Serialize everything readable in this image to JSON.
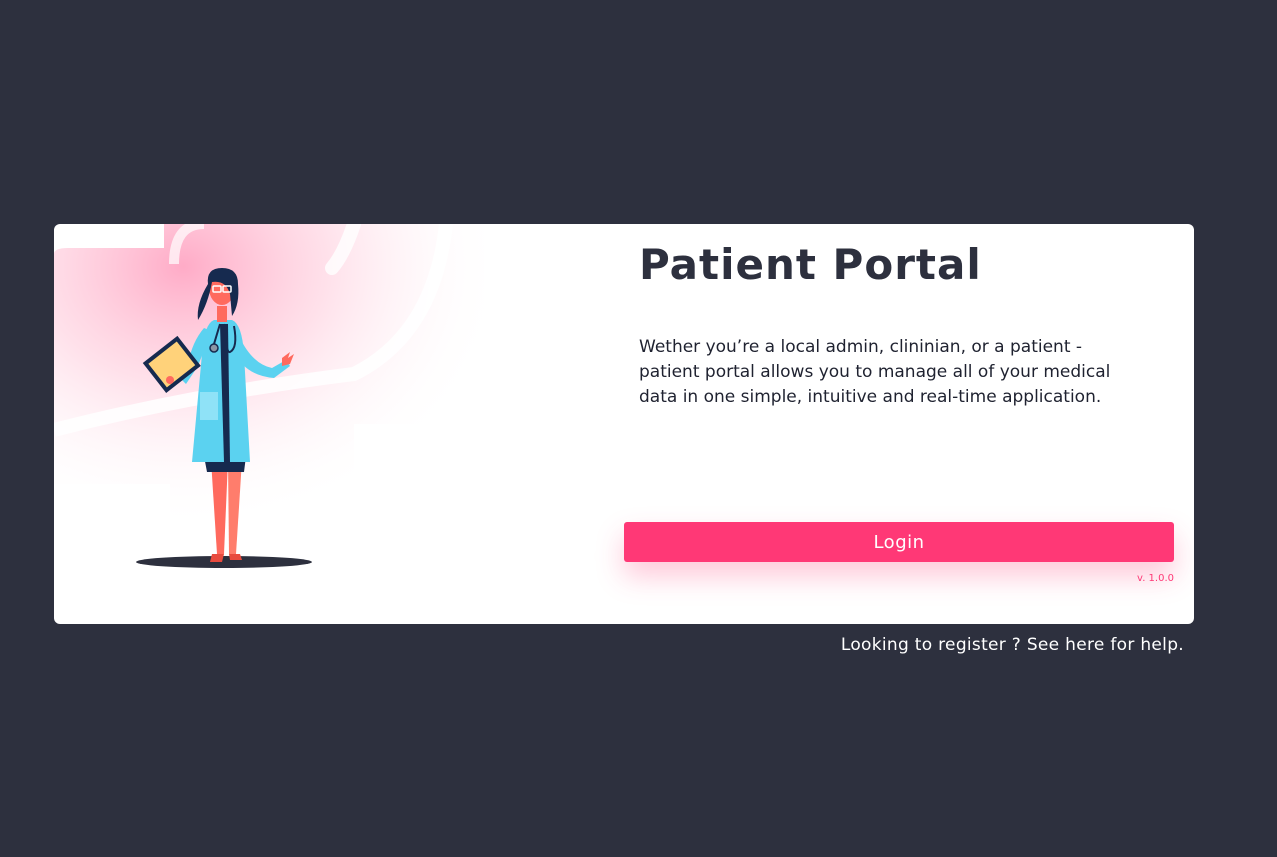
{
  "card": {
    "title": "Patient Portal",
    "description": "Wether you’re a local admin, clininian, or a patient - patient portal allows you to manage all of your medical data in one simple, intuitive and real-time application.",
    "login_label": "Login",
    "version": "v. 1.0.0"
  },
  "footer": {
    "register_text": "Looking to register ? See here for help."
  },
  "illustration": {
    "subject": "doctor-icon"
  },
  "colors": {
    "background": "#2d303e",
    "card": "#ffffff",
    "accent": "#ff3876",
    "title": "#2d303e",
    "text": "#1f2230",
    "coat": "#5bd2f0",
    "coat_dark": "#162a4f",
    "skin": "#ff6a5e",
    "clipboard": "#ffd27a"
  }
}
